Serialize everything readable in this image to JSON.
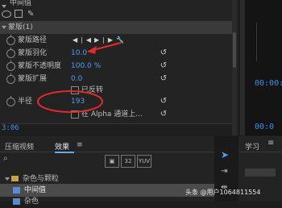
{
  "effect_controls": {
    "section_top_label": "中间值",
    "mask_section": "蒙版(1)",
    "mask_path_label": "蒙版路径",
    "mask_feather_label": "蒙版羽化",
    "mask_feather_value": "10.0",
    "mask_opacity_label": "蒙版不透明度",
    "mask_opacity_value": "100.0 %",
    "mask_expansion_label": "蒙版扩展",
    "mask_expansion_value": "0.0",
    "inverted_label": "已反转",
    "radius_label": "半径",
    "radius_value": "193",
    "alpha_label": "在 Alpha 通道上...",
    "timecode": "3:06"
  },
  "right_panel": {
    "timecode_top": "00:00:",
    "timecode_bottom": "00:0"
  },
  "bottom_panel": {
    "tabs": [
      "压缩视频",
      "效果"
    ],
    "menu_glyph": "≡",
    "icons": [
      "32",
      "YUV"
    ],
    "items": [
      "杂色与颗粒",
      "中间值",
      "杂色"
    ],
    "learn_tab": "学习"
  },
  "watermark": "头条 @用户1064811554",
  "colors": {
    "accent": "#4f9bf5",
    "annotation": "#e32b2b"
  }
}
